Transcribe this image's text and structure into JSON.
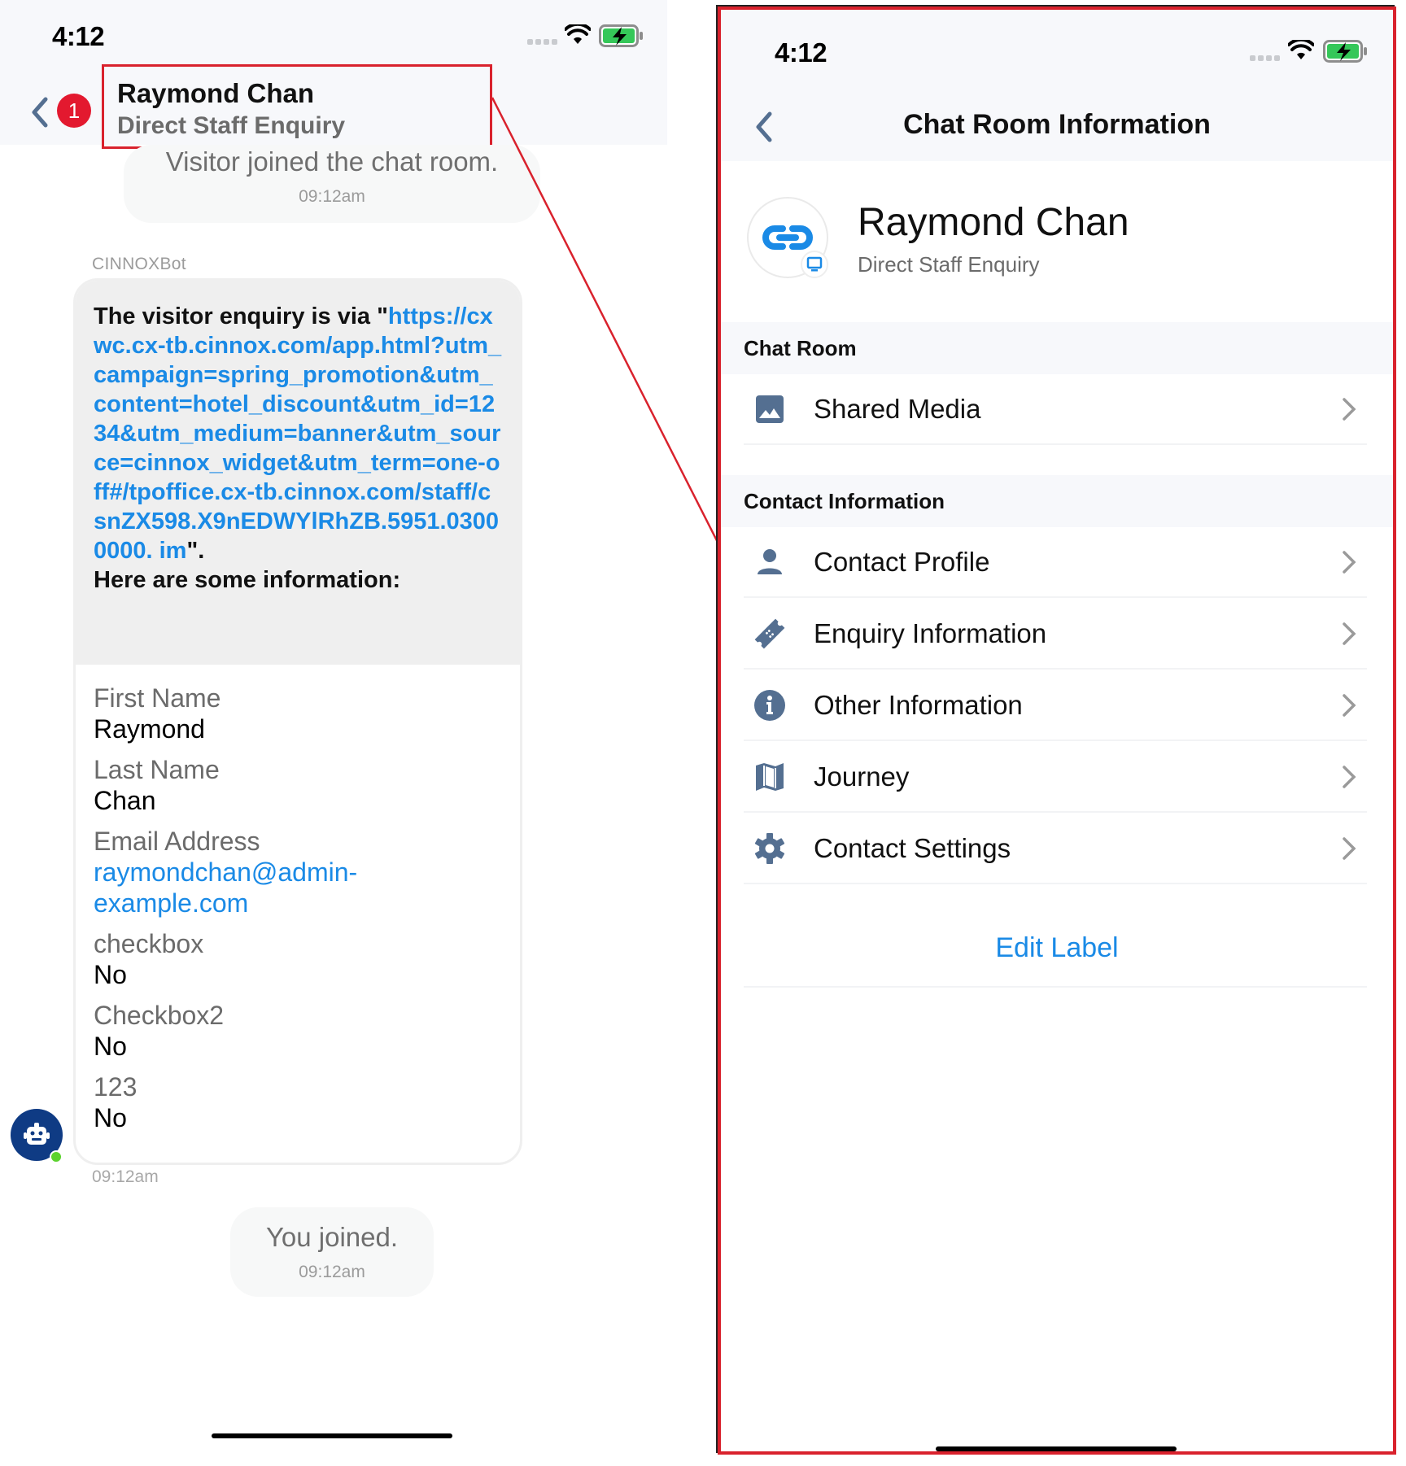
{
  "left_screen": {
    "status_bar": {
      "time": "4:12"
    },
    "header": {
      "back_icon": "chevron-left-icon",
      "unread_badge": "1",
      "title": "Raymond Chan",
      "subtitle": "Direct Staff Enquiry"
    },
    "messages": {
      "visitor_joined": {
        "text": "Visitor joined the chat room.",
        "time": "09:12am"
      },
      "bot_message": {
        "sender": "CINNOXBot",
        "intro_prefix": "The visitor enquiry is via \"",
        "url": "https://cxwc.cx-tb.cinnox.com/app.html?utm_campaign=spring_promotion&utm_content=hotel_discount&utm_id=1234&utm_medium=banner&utm_source=cinnox_widget&utm_term=one-off#/tpoffice.cx-tb.cinnox.com/staff/csnZX598.X9nEDWYlRhZB.5951.03000000. im",
        "intro_suffix": "\".",
        "info_heading": "Here are some information:",
        "fields": [
          {
            "label": "First Name",
            "value": "Raymond"
          },
          {
            "label": "Last Name",
            "value": "Chan"
          },
          {
            "label": "Email Address",
            "value": "raymondchan@admin-example.com"
          },
          {
            "label": "checkbox",
            "value": "No"
          },
          {
            "label": "Checkbox2",
            "value": "No"
          },
          {
            "label": "123",
            "value": "No"
          }
        ],
        "time": "09:12am"
      },
      "you_joined": {
        "text": "You joined.",
        "time": "09:12am"
      }
    }
  },
  "right_screen": {
    "status_bar": {
      "time": "4:12"
    },
    "nav": {
      "back_icon": "chevron-left-icon",
      "title": "Chat Room Information"
    },
    "profile": {
      "name": "Raymond Chan",
      "subtitle": "Direct Staff Enquiry",
      "avatar_icon": "link-icon",
      "channel_icon": "monitor-icon"
    },
    "sections": [
      {
        "title": "Chat Room",
        "items": [
          {
            "label": "Shared Media",
            "icon": "image-icon"
          }
        ]
      },
      {
        "title": "Contact Information",
        "items": [
          {
            "label": "Contact Profile",
            "icon": "person-icon"
          },
          {
            "label": "Enquiry Information",
            "icon": "ticket-icon"
          },
          {
            "label": "Other Information",
            "icon": "info-icon"
          },
          {
            "label": "Journey",
            "icon": "map-icon"
          },
          {
            "label": "Contact Settings",
            "icon": "gear-icon"
          }
        ]
      }
    ],
    "edit_label": "Edit Label"
  },
  "colors": {
    "accent_blue": "#1a8ae6",
    "annotation_red": "#d9222d",
    "badge_red": "#e3192f",
    "icon_slate": "#546f91",
    "bot_navy": "#0f3b84",
    "online_green": "#5bd22e"
  }
}
